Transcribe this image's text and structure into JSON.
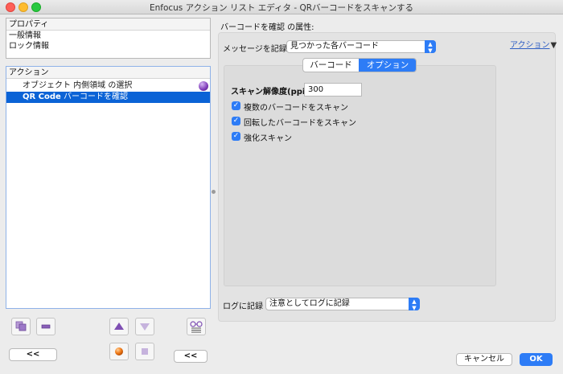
{
  "window": {
    "title": "Enfocus アクション リスト エディタ - QRバーコードをスキャンする"
  },
  "properties": {
    "header": "プロパティ",
    "items": [
      "一般情報",
      "ロック情報"
    ]
  },
  "actions": {
    "header": "アクション",
    "rows": [
      {
        "label": "オブジェクト 内側領域 の選択"
      },
      {
        "bold": "QR Code",
        "rest": " バーコードを確認"
      }
    ]
  },
  "left_toolbar": {
    "collapse_label": "<<",
    "collapse_label_2": "<<"
  },
  "detail": {
    "title": "バーコードを確認 の属性:",
    "message_label": "メッセージを記録",
    "message_value": "見つかった各バーコード",
    "action_link": "アクション",
    "tabs": [
      "バーコード",
      "オプション"
    ],
    "active_tab": "オプション",
    "resolution_label": "スキャン解像度(ppi):",
    "resolution_value": "300",
    "options": [
      {
        "label": "複数のバーコードをスキャン",
        "checked": true
      },
      {
        "label": "回転したバーコードをスキャン",
        "checked": true
      },
      {
        "label": "強化スキャン",
        "checked": true
      }
    ],
    "log_label": "ログに記録",
    "log_value": "注意としてログに記録"
  },
  "footer": {
    "cancel": "キャンセル",
    "ok": "OK"
  },
  "colors": {
    "accent": "#2d7cf6",
    "selection": "#0b63d6",
    "link": "#2f5fc4"
  }
}
